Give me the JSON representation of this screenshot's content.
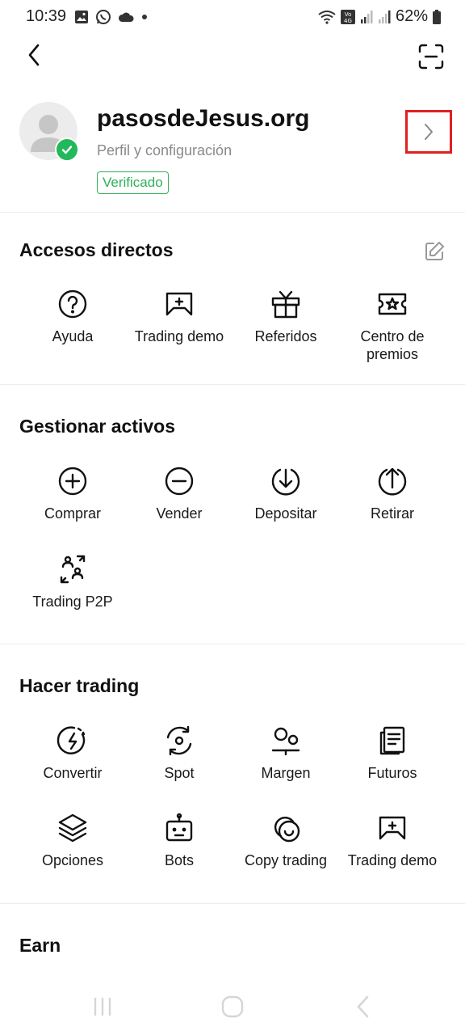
{
  "status_bar": {
    "time": "10:39",
    "battery": "62%",
    "icons_left": [
      "image-icon",
      "whatsapp-icon",
      "cloud-icon",
      "dot-icon"
    ],
    "icons_right": [
      "wifi-icon",
      "volte-4g-icon",
      "signal-icon",
      "signal-icon",
      "battery-icon"
    ]
  },
  "topbar": {
    "back_icon": "chevron-left-icon",
    "scan_icon": "scan-icon"
  },
  "profile": {
    "name": "pasosdeJesus.org",
    "subtitle": "Perfil y configuración",
    "badge": "Verificado",
    "badge_color": "#2fb05a",
    "highlight_color": "#e02020"
  },
  "sections": {
    "shortcuts": {
      "title": "Accesos directos",
      "items": [
        {
          "label": "Ayuda",
          "icon": "help-circle-icon"
        },
        {
          "label": "Trading demo",
          "icon": "gamepad-icon"
        },
        {
          "label": "Referidos",
          "icon": "gift-icon"
        },
        {
          "label": "Centro de premios",
          "icon": "ticket-star-icon"
        }
      ]
    },
    "assets": {
      "title": "Gestionar activos",
      "items": [
        {
          "label": "Comprar",
          "icon": "plus-circle-icon"
        },
        {
          "label": "Vender",
          "icon": "minus-circle-icon"
        },
        {
          "label": "Depositar",
          "icon": "arrow-down-icon"
        },
        {
          "label": "Retirar",
          "icon": "arrow-up-icon"
        },
        {
          "label": "Trading P2P",
          "icon": "p2p-icon"
        }
      ]
    },
    "trading": {
      "title": "Hacer trading",
      "items": [
        {
          "label": "Convertir",
          "icon": "convert-icon"
        },
        {
          "label": "Spot",
          "icon": "spot-icon"
        },
        {
          "label": "Margen",
          "icon": "margin-icon"
        },
        {
          "label": "Futuros",
          "icon": "futures-icon"
        },
        {
          "label": "Opciones",
          "icon": "layers-icon"
        },
        {
          "label": "Bots",
          "icon": "robot-icon"
        },
        {
          "label": "Copy trading",
          "icon": "copy-trading-icon"
        },
        {
          "label": "Trading demo",
          "icon": "gamepad-icon"
        }
      ]
    },
    "earn": {
      "title": "Earn"
    }
  },
  "nav": {
    "recents": "recents-icon",
    "home": "home-icon",
    "back": "back-icon"
  }
}
